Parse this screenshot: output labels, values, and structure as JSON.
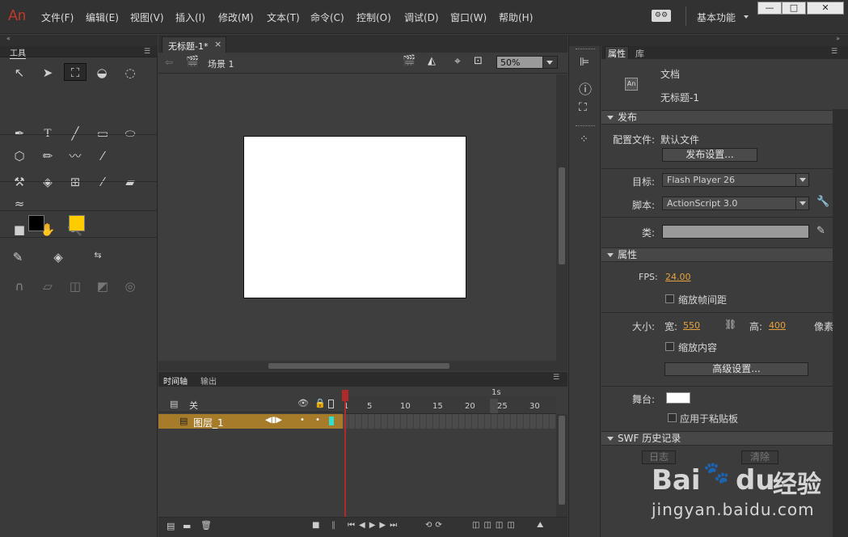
{
  "app": {
    "logo": "An"
  },
  "menu": [
    "文件(F)",
    "编辑(E)",
    "视图(V)",
    "插入(I)",
    "修改(M)",
    "文本(T)",
    "命令(C)",
    "控制(O)",
    "调试(D)",
    "窗口(W)",
    "帮助(H)"
  ],
  "workspace": {
    "label": "基本功能"
  },
  "tools": {
    "header": "工具"
  },
  "document": {
    "tab": "无标题-1*",
    "tab_close": "×",
    "scene": "场景 1",
    "zoom": "50%"
  },
  "timeline": {
    "tab_timeline": "时间轴",
    "tab_output": "输出",
    "header_label": "关",
    "layer_name": "图层_1",
    "ruler": [
      "1",
      "5",
      "10",
      "15",
      "20",
      "25",
      "30"
    ],
    "second_marker": "1s"
  },
  "properties": {
    "tab_props": "属性",
    "tab_lib": "库",
    "doc_type": "文档",
    "doc_name": "无标题-1",
    "doc_icon": "An",
    "publish_header": "发布",
    "profile_label": "配置文件:",
    "profile_value": "默认文件",
    "publish_settings_btn": "发布设置...",
    "target_label": "目标:",
    "target_value": "Flash Player 26",
    "script_label": "脚本:",
    "script_value": "ActionScript 3.0",
    "class_label": "类:",
    "props_header": "属性",
    "fps_label": "FPS:",
    "fps_value": "24.00",
    "scale_spans": "缩放帧间距",
    "size_label": "大小:",
    "width_label": "宽:",
    "width_value": "550",
    "height_label": "高:",
    "height_value": "400",
    "unit": "像素",
    "scale_content": "缩放内容",
    "advanced_btn": "高级设置...",
    "stage_label": "舞台:",
    "apply_pasteboard": "应用于粘贴板",
    "swf_header": "SWF 历史记录",
    "log_btn": "日志",
    "clear_btn": "清除"
  },
  "watermark": {
    "brand": "Bai",
    "brand2": "du",
    "brand_cn": "经验",
    "url": "jingyan.baidu.com"
  },
  "colors": {
    "accent_orange": "#e8a23c",
    "layer_highlight": "#a67c2a",
    "playhead": "#b02a2a",
    "fill_color": "#ffcc00",
    "stroke_color": "#000000"
  }
}
